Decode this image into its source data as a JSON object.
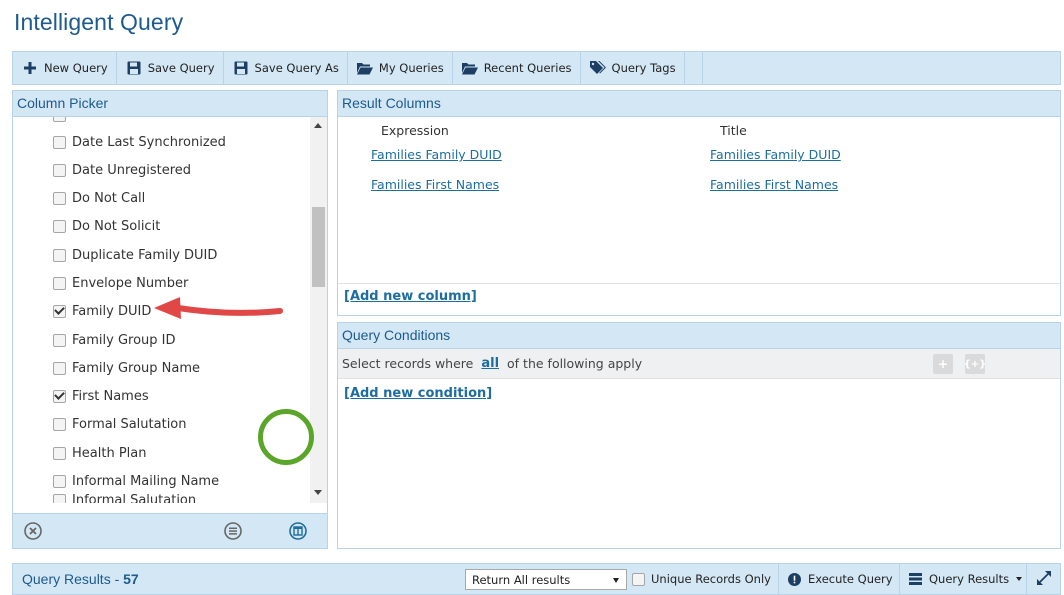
{
  "page": {
    "title": "Intelligent Query"
  },
  "toolbar": {
    "new_query": "New Query",
    "save_query": "Save Query",
    "save_query_as": "Save Query As",
    "my_queries": "My Queries",
    "recent_queries": "Recent Queries",
    "query_tags": "Query Tags"
  },
  "column_picker": {
    "title": "Column Picker",
    "items": [
      {
        "label": "Date Last Synchronized",
        "checked": false
      },
      {
        "label": "Date Unregistered",
        "checked": false
      },
      {
        "label": "Do Not Call",
        "checked": false
      },
      {
        "label": "Do Not Solicit",
        "checked": false
      },
      {
        "label": "Duplicate Family DUID",
        "checked": false
      },
      {
        "label": "Envelope Number",
        "checked": false
      },
      {
        "label": "Family DUID",
        "checked": true
      },
      {
        "label": "Family Group ID",
        "checked": false
      },
      {
        "label": "Family Group Name",
        "checked": false
      },
      {
        "label": "First Names",
        "checked": true
      },
      {
        "label": "Formal Salutation",
        "checked": false
      },
      {
        "label": "Health Plan",
        "checked": false
      },
      {
        "label": "Informal Mailing Name",
        "checked": false
      },
      {
        "label": "Informal Salutation",
        "checked": false
      }
    ]
  },
  "result_columns": {
    "title": "Result Columns",
    "header_expression": "Expression",
    "header_title": "Title",
    "rows": [
      {
        "expression": "Families Family DUID",
        "title": "Families Family DUID"
      },
      {
        "expression": "Families First Names",
        "title": "Families First Names"
      }
    ],
    "add_label": "[Add new column]"
  },
  "conditions": {
    "title": "Query Conditions",
    "prefix": "Select records where",
    "mode": "all",
    "suffix": "of the following apply",
    "add_label": "[Add new condition]"
  },
  "results": {
    "title": "Query Results - ",
    "count": "57",
    "return_option": "Return All results",
    "unique_label": "Unique Records Only",
    "execute_label": "Execute Query",
    "results_menu_label": "Query Results"
  },
  "colors": {
    "accent": "#1d5a8e",
    "panel_bg": "#d4e7f5",
    "link": "#1d6e9e",
    "annotation_arrow": "#e04848",
    "annotation_ring": "#5aa52a"
  }
}
